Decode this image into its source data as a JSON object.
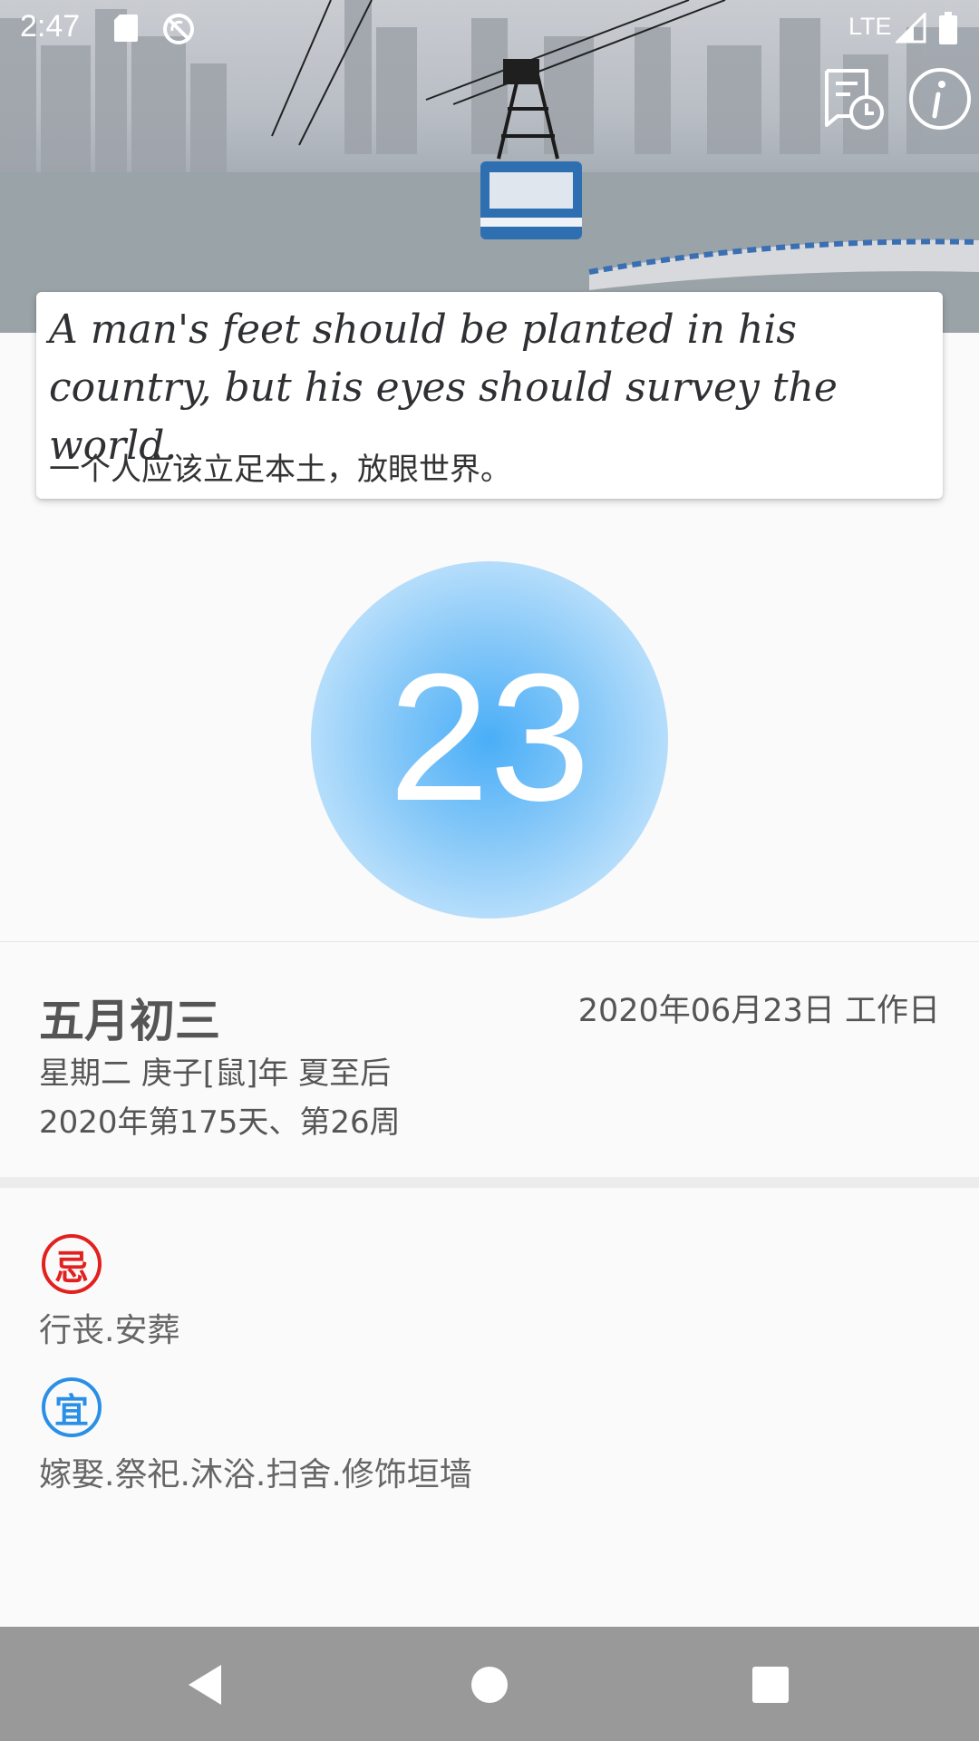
{
  "status_bar": {
    "time": "2:47",
    "network": "LTE",
    "icons": [
      "sd-card-icon",
      "no-sync-icon",
      "signal-icon",
      "battery-icon"
    ]
  },
  "header": {
    "actions": [
      "history-icon",
      "info-icon"
    ]
  },
  "quote": {
    "english": "A man's feet should be planted in his country, but his eyes should survey the world.",
    "chinese": "一个人应该立足本土，放眼世界。"
  },
  "day": {
    "number": "23",
    "circle_color": "#4aaef7"
  },
  "date_info": {
    "lunar": "五月初三",
    "solar": "2020年06月23日 工作日",
    "weekday_line": "星期二 庚子[鼠]年 夏至后",
    "day_of_year_line": "2020年第175天、第26周"
  },
  "almanac": {
    "avoid": {
      "seal": "忌",
      "color": "#e32020",
      "items": "行丧.安葬"
    },
    "suitable": {
      "seal": "宜",
      "color": "#2a8fe6",
      "items": "嫁娶.祭祀.沐浴.扫舍.修饰垣墙"
    }
  },
  "nav_bar": {
    "buttons": [
      "back-icon",
      "home-icon",
      "recents-icon"
    ]
  }
}
